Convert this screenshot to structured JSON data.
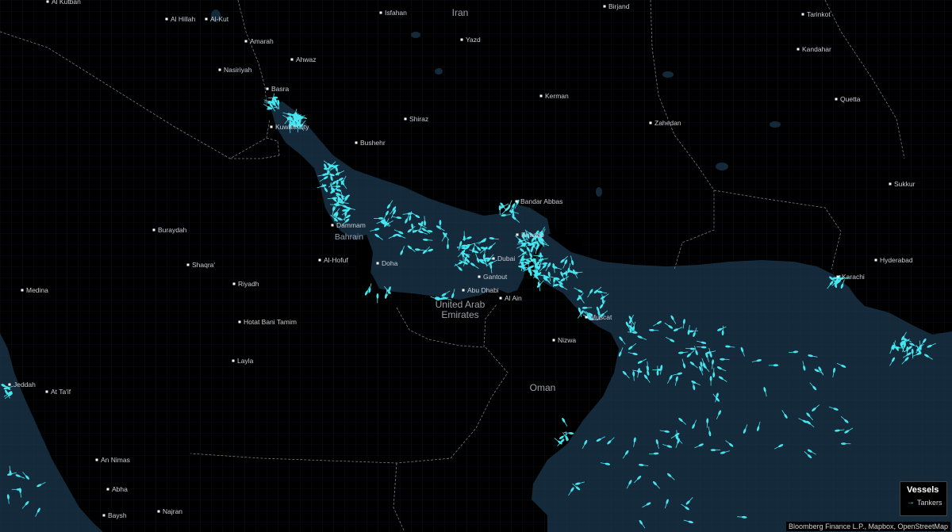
{
  "map": {
    "colors": {
      "land": "#000000",
      "water": "#14293a",
      "vessel": "#46e6f0",
      "border": "#7a7a7a"
    },
    "countries": [
      {
        "id": "iran",
        "name": "Iran"
      },
      {
        "id": "uae",
        "name": "United Arab\nEmirates"
      },
      {
        "id": "oman",
        "name": "Oman"
      }
    ],
    "water_labels": [
      {
        "id": "bahrain",
        "name": "Bahrain"
      }
    ],
    "cities": [
      {
        "id": "kutaban",
        "name": "Al Kutban"
      },
      {
        "id": "al-hillah",
        "name": "Al Hillah"
      },
      {
        "id": "al-kut",
        "name": "Al-Kut"
      },
      {
        "id": "isfahan",
        "name": "Isfahan"
      },
      {
        "id": "birjand",
        "name": "Birjand"
      },
      {
        "id": "tarinkot",
        "name": "Tarinkot"
      },
      {
        "id": "yazd",
        "name": "Yazd"
      },
      {
        "id": "amarah",
        "name": "Amarah"
      },
      {
        "id": "ahwaz",
        "name": "Ahwaz"
      },
      {
        "id": "kandahar",
        "name": "Kandahar"
      },
      {
        "id": "nasiriyah",
        "name": "Nasiriyah"
      },
      {
        "id": "basra",
        "name": "Basra"
      },
      {
        "id": "kerman",
        "name": "Kerman"
      },
      {
        "id": "quetta",
        "name": "Quetta"
      },
      {
        "id": "shiraz",
        "name": "Shiraz"
      },
      {
        "id": "zahedan",
        "name": "Zahedan"
      },
      {
        "id": "kuwait",
        "name": "Kuwait City"
      },
      {
        "id": "bushehr",
        "name": "Bushehr"
      },
      {
        "id": "sukkur",
        "name": "Sukkur"
      },
      {
        "id": "bandar-abbas",
        "name": "Bandar Abbas"
      },
      {
        "id": "dammam",
        "name": "Dammam"
      },
      {
        "id": "buraydah",
        "name": "Buraydah"
      },
      {
        "id": "khasab",
        "name": "Khasab"
      },
      {
        "id": "al-hofuf",
        "name": "Al-Hofuf"
      },
      {
        "id": "doha",
        "name": "Doha"
      },
      {
        "id": "dubai",
        "name": "Dubai"
      },
      {
        "id": "hyderabad",
        "name": "Hyderabad"
      },
      {
        "id": "shaqra",
        "name": "Shaqra'"
      },
      {
        "id": "gantout",
        "name": "Gantout"
      },
      {
        "id": "karachi",
        "name": "Karachi"
      },
      {
        "id": "riyadh",
        "name": "Riyadh"
      },
      {
        "id": "abu-dhabi",
        "name": "Abu Dhabi"
      },
      {
        "id": "medina",
        "name": "Medina"
      },
      {
        "id": "al-ain",
        "name": "Al Ain"
      },
      {
        "id": "muscat",
        "name": "Muscat"
      },
      {
        "id": "hotat",
        "name": "Hotat Bani Tamim"
      },
      {
        "id": "nizwa",
        "name": "Nizwa"
      },
      {
        "id": "layla",
        "name": "Layla"
      },
      {
        "id": "jeddah",
        "name": "Jeddah"
      },
      {
        "id": "at-taif",
        "name": "At Ta'if"
      },
      {
        "id": "an-nimas",
        "name": "An Nimas"
      },
      {
        "id": "abha",
        "name": "Abha"
      },
      {
        "id": "najran",
        "name": "Najran"
      },
      {
        "id": "baysh",
        "name": "Baysh"
      }
    ]
  },
  "legend": {
    "title": "Vessels",
    "items": [
      {
        "label": "Tankers",
        "icon": "arrow-icon",
        "color": "#46e6f0"
      }
    ]
  },
  "attribution": "Bloomberg Finance L.P., Mapbox, OpenStreetMap"
}
